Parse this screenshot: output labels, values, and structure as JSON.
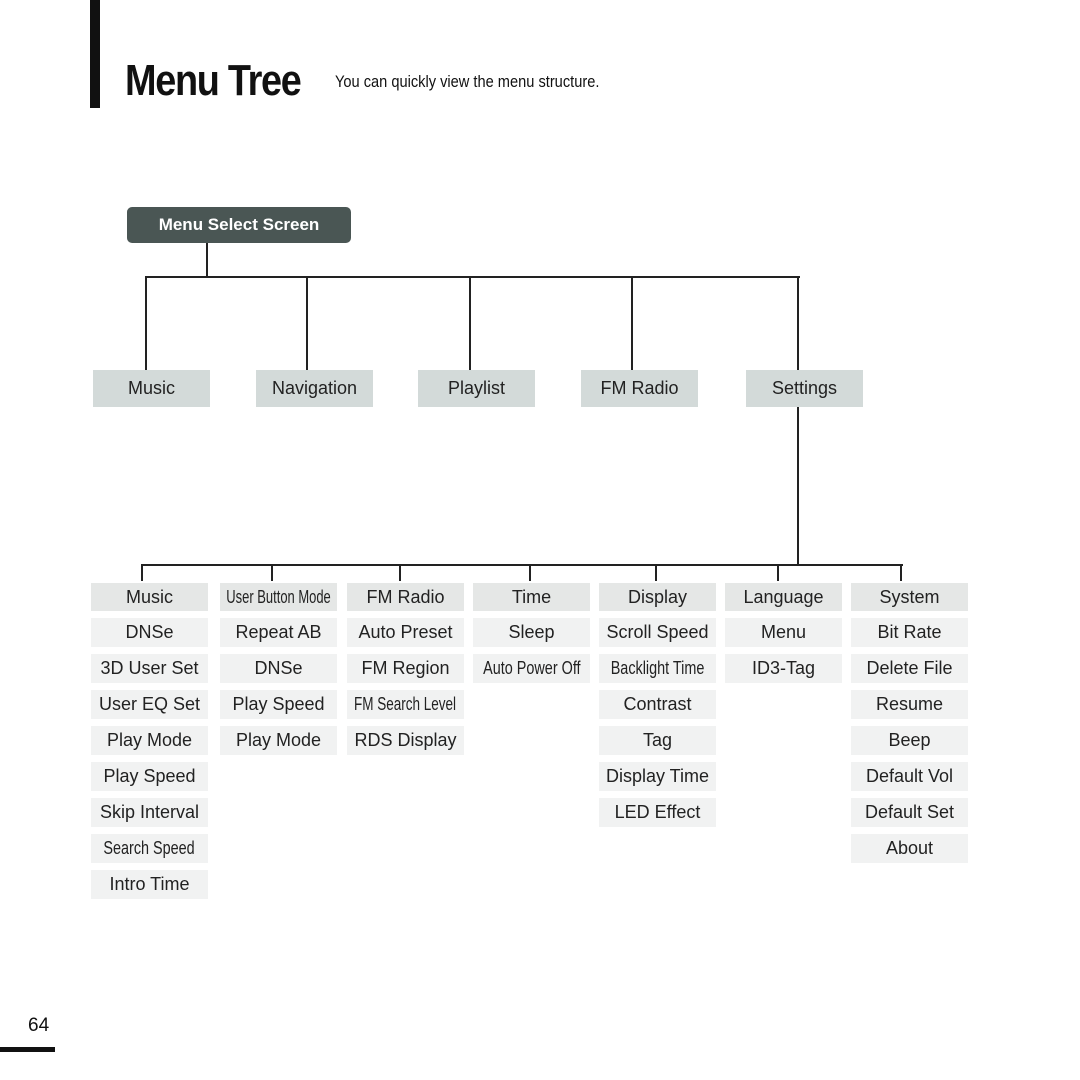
{
  "header": {
    "title": "Menu Tree",
    "subtitle": "You can quickly view the menu structure."
  },
  "root": {
    "label": "Menu Select Screen"
  },
  "top_level": [
    {
      "label": "Music"
    },
    {
      "label": "Navigation"
    },
    {
      "label": "Playlist"
    },
    {
      "label": "FM Radio"
    },
    {
      "label": "Settings"
    }
  ],
  "settings_children": [
    {
      "label": "Music",
      "items": [
        "DNSe",
        "3D User Set",
        "User EQ Set",
        "Play Mode",
        "Play Speed",
        "Skip Interval",
        "Search Speed",
        "Intro Time"
      ]
    },
    {
      "label": "User Button Mode",
      "items": [
        "Repeat AB",
        "DNSe",
        "Play Speed",
        "Play Mode"
      ]
    },
    {
      "label": "FM Radio",
      "items": [
        "Auto Preset",
        "FM Region",
        "FM Search Level",
        "RDS Display"
      ]
    },
    {
      "label": "Time",
      "items": [
        "Sleep",
        "Auto Power Off"
      ]
    },
    {
      "label": "Display",
      "items": [
        "Scroll Speed",
        "Backlight Time",
        "Contrast",
        "Tag",
        "Display Time",
        "LED Effect"
      ]
    },
    {
      "label": "Language",
      "items": [
        "Menu",
        "ID3-Tag"
      ]
    },
    {
      "label": "System",
      "items": [
        "Bit Rate",
        "Delete File",
        "Resume",
        "Beep",
        "Default Vol",
        "Default Set",
        "About"
      ]
    }
  ],
  "footer": {
    "page_number": "64"
  },
  "colors": {
    "root_box": "#4a5654",
    "top_level_box": "#d3dad9",
    "sub_header_box": "#e5e7e6",
    "sub_item_box": "#f1f2f2",
    "connector": "#222222"
  }
}
